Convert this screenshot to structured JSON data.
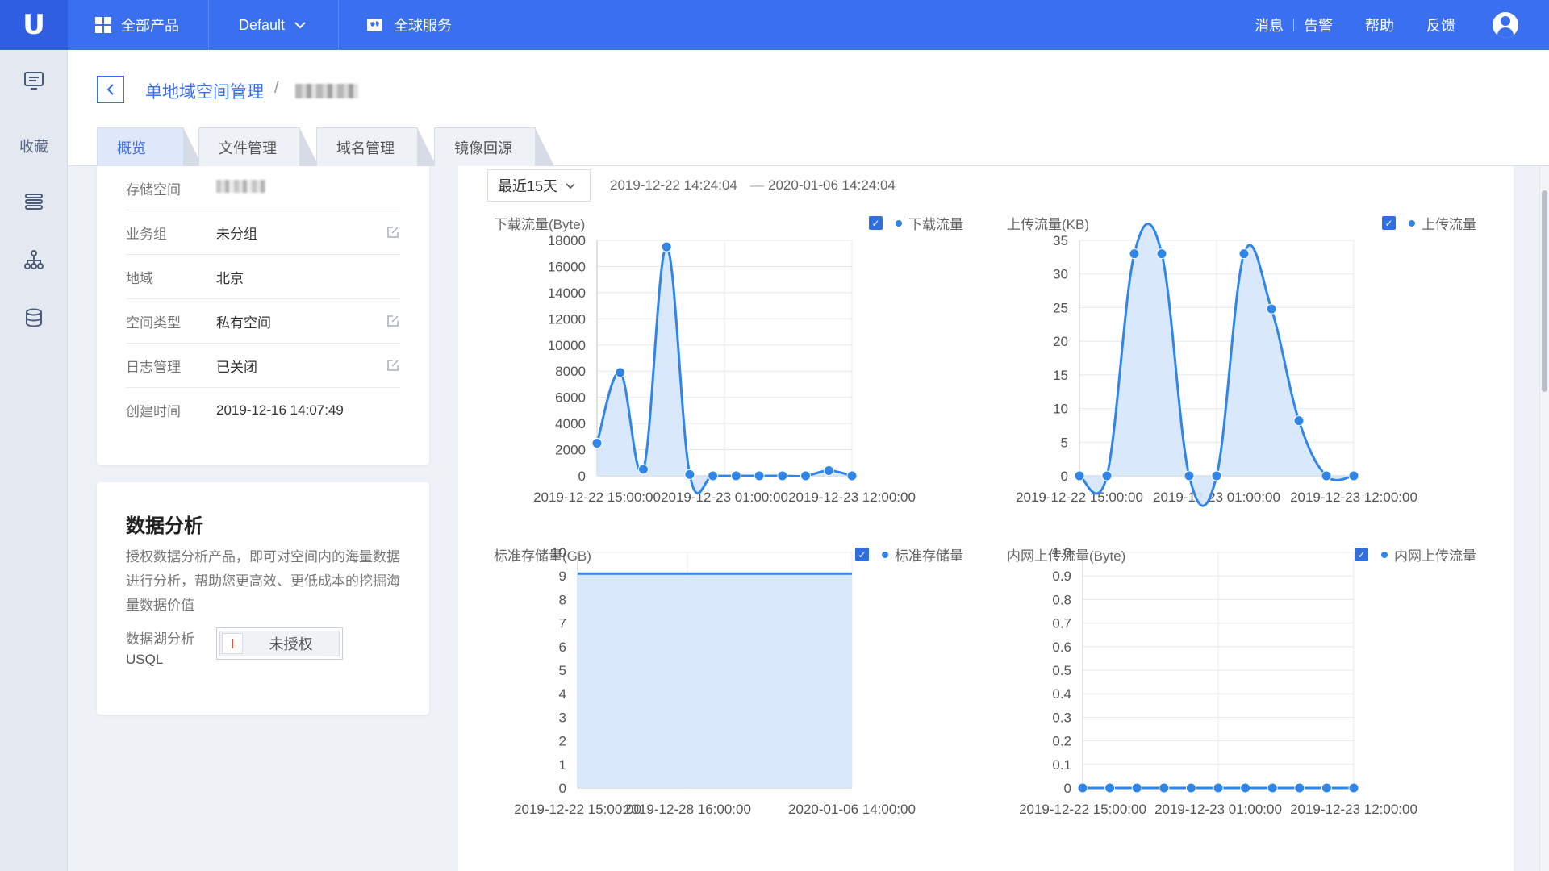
{
  "topbar": {
    "logo": "U",
    "all_products": "全部产品",
    "project": "Default",
    "global_services": "全球服务",
    "messages": "消息",
    "alarms": "告警",
    "help": "帮助",
    "feedback": "反馈"
  },
  "sidebar": {
    "favorites": "收藏"
  },
  "breadcrumb": {
    "parent": "单地域空间管理",
    "separator": "/"
  },
  "tabs": [
    "概览",
    "文件管理",
    "域名管理",
    "镜像回源"
  ],
  "info": {
    "rows": [
      {
        "label": "存储空间",
        "value": ""
      },
      {
        "label": "业务组",
        "value": "未分组"
      },
      {
        "label": "地域",
        "value": "北京"
      },
      {
        "label": "空间类型",
        "value": "私有空间"
      },
      {
        "label": "日志管理",
        "value": "已关闭"
      },
      {
        "label": "创建时间",
        "value": "2019-12-16 14:07:49"
      }
    ]
  },
  "analysis": {
    "title": "数据分析",
    "description": "授权数据分析产品，即可对空间内的海量数据进行分析，帮助您更高效、更低成本的挖掘海量数据价值",
    "feature_label": "数据湖分析",
    "feature_name": "USQL",
    "toggle_text": "未授权"
  },
  "range": {
    "selected": "最近15天",
    "start": "2019-12-22 14:24:04",
    "end": "2020-01-06 14:24:04",
    "dash": "—"
  },
  "colors": {
    "accent": "#3a6ff0",
    "series": "#2f86e8",
    "fill": "#d6e6fb"
  },
  "chart_data": [
    {
      "type": "area",
      "title": "下载流量(Byte)",
      "legend": "下载流量",
      "ylim": [
        0,
        18000
      ],
      "yticks": [
        0,
        2000,
        4000,
        6000,
        8000,
        10000,
        12000,
        14000,
        16000,
        18000
      ],
      "xtick_labels": [
        "2019-12-22 15:00:00",
        "2019-12-23 01:00:00",
        "2019-12-23 12:00:00"
      ],
      "series": [
        {
          "values": [
            2500,
            7900,
            500,
            17500,
            100,
            0,
            0,
            0,
            0,
            0,
            400,
            0
          ]
        }
      ]
    },
    {
      "type": "area",
      "title": "上传流量(KB)",
      "legend": "上传流量",
      "ylim": [
        0,
        35
      ],
      "yticks": [
        0,
        5,
        10,
        15,
        20,
        25,
        30,
        35
      ],
      "xtick_labels": [
        "2019-12-22 15:00:00",
        "2019-12-23 01:00:00",
        "2019-12-23 12:00:00"
      ],
      "series": [
        {
          "values": [
            0,
            0,
            33,
            33,
            0,
            0,
            33,
            24.8,
            8.2,
            0,
            0
          ]
        }
      ]
    },
    {
      "type": "area",
      "title": "标准存储量(GB)",
      "legend": "标准存储量",
      "ylim": [
        0,
        10
      ],
      "yticks": [
        0,
        1,
        2,
        3,
        4,
        5,
        6,
        7,
        8,
        9,
        10
      ],
      "xtick_labels": [
        "2019-12-22 15:00:00",
        "2019-12-28 16:00:00",
        "2020-01-06 14:00:00"
      ],
      "series": [
        {
          "values": [
            9.1,
            9.1
          ]
        }
      ]
    },
    {
      "type": "line",
      "title": "内网上传流量(Byte)",
      "legend": "内网上传流量",
      "ylim": [
        0,
        1
      ],
      "yticks": [
        "0",
        "0.1",
        "0.2",
        "0.3",
        "0.4",
        "0.5",
        "0.6",
        "0.7",
        "0.8",
        "0.9",
        "1.0"
      ],
      "xtick_labels": [
        "2019-12-22 15:00:00",
        "2019-12-23 01:00:00",
        "2019-12-23 12:00:00"
      ],
      "series": [
        {
          "values": [
            0,
            0,
            0,
            0,
            0,
            0,
            0,
            0,
            0,
            0,
            0
          ]
        }
      ]
    }
  ]
}
